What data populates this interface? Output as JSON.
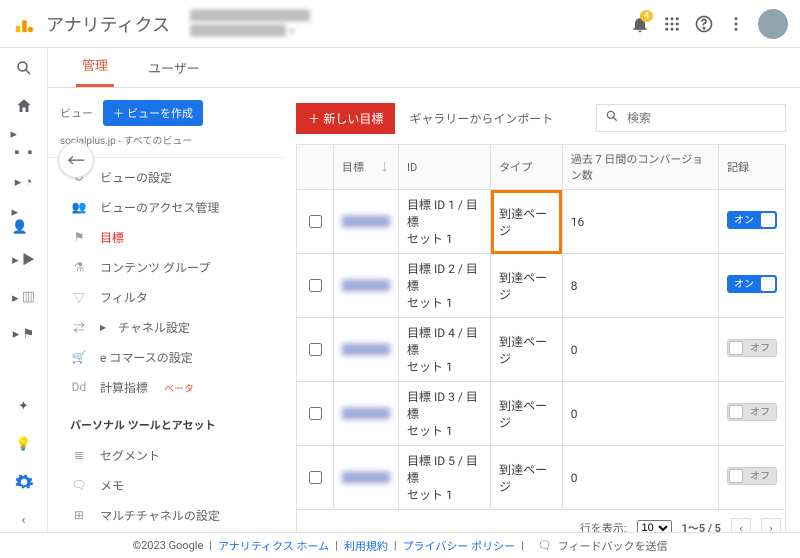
{
  "topbar": {
    "title": "アナリティクス",
    "notification_count": "4"
  },
  "subtabs": {
    "admin": "管理",
    "user": "ユーザー"
  },
  "view": {
    "label": "ビュー",
    "create_btn": "＋ ビューを作成",
    "crumb": "socialplus.jp - すべてのビュー"
  },
  "admin_nav": {
    "items": [
      {
        "icon": "⚙",
        "label": "ビューの設定"
      },
      {
        "icon": "👥",
        "label": "ビューのアクセス管理"
      },
      {
        "icon": "⚑",
        "label": "目標",
        "active": true
      },
      {
        "icon": "⚗",
        "label": "コンテンツ グループ"
      },
      {
        "icon": "▽",
        "label": "フィルタ"
      },
      {
        "icon": "⇄",
        "label": "チャネル設定",
        "chev": true
      },
      {
        "icon": "🛒",
        "label": "e コマースの設定"
      },
      {
        "icon": "Dd",
        "label": "計算指標",
        "beta": "ベータ"
      }
    ],
    "section_heading": "パーソナル ツールとアセット",
    "section_items": [
      {
        "icon": "≣",
        "label": "セグメント"
      },
      {
        "icon": "🗨",
        "label": "メモ"
      },
      {
        "icon": "⊞",
        "label": "マルチチャネルの設定"
      }
    ]
  },
  "goals": {
    "new_btn": "＋ 新しい目標",
    "import_link": "ギャラリーからインポート",
    "search_placeholder": "検索",
    "headers": {
      "name": "目標",
      "id": "ID",
      "type": "タイプ",
      "conversions": "過去 7 日間のコンバージョン数",
      "recording": "記録"
    },
    "rows": [
      {
        "name": "████",
        "id_line1": "目標 ID 1 / 目標",
        "id_line2": "セット 1",
        "type": "到達ページ",
        "conv": "16",
        "on": true,
        "highlight": true
      },
      {
        "name": "████",
        "id_line1": "目標 ID 2 / 目標",
        "id_line2": "セット 1",
        "type": "到達ページ",
        "conv": "8",
        "on": true
      },
      {
        "name": "████",
        "id_line1": "目標 ID 4 / 目標",
        "id_line2": "セット 1",
        "type": "到達ページ",
        "conv": "0",
        "on": false
      },
      {
        "name": "████",
        "id_line1": "目標 ID 3 / 目標",
        "id_line2": "セット 1",
        "type": "到達ページ",
        "conv": "0",
        "on": false
      },
      {
        "name": "████",
        "id_line1": "目標 ID 5 / 目標",
        "id_line2": "セット 1",
        "type": "到達ページ",
        "conv": "0",
        "on": false
      }
    ],
    "toggle_on_label": "オン",
    "toggle_off_label": "オフ",
    "pager": {
      "rows_label": "行を表示:",
      "rows_value": "10",
      "range": "1～5 / 5"
    }
  },
  "footer": {
    "copyright": "©2023 Google",
    "links": [
      "アナリティクス ホーム",
      "利用規約",
      "プライバシー ポリシー"
    ],
    "feedback": "フィードバックを送信",
    "sep": " | "
  }
}
